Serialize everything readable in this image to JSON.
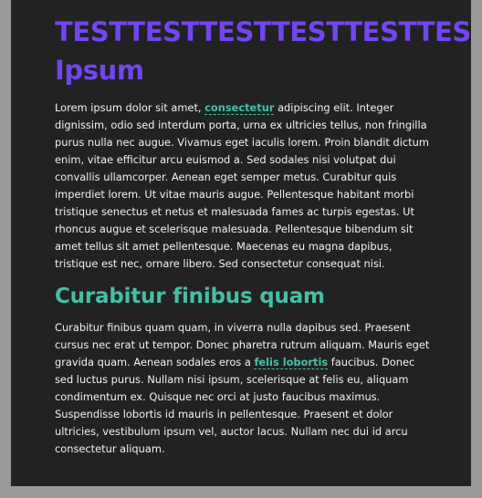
{
  "article": {
    "title_line1": "TESTTESTTESTTESTTESTTESTLorem",
    "title_line2": "Ipsum",
    "para1_before": "Lorem ipsum dolor sit amet, ",
    "para1_link": "consectetur",
    "para1_after": " adipiscing elit. Integer dignissim, odio sed interdum porta, urna ex ultricies tellus, non fringilla purus nulla nec augue. Vivamus eget iaculis lorem. Proin blandit dictum enim, vitae efficitur arcu euismod a. Sed sodales nisi volutpat dui convallis ullamcorper. Aenean eget semper metus. Curabitur quis imperdiet lorem. Ut vitae mauris augue. Pellentesque habitant morbi tristique senectus et netus et malesuada fames ac turpis egestas. Ut rhoncus augue et scelerisque malesuada. Pellentesque bibendum sit amet tellus sit amet pellentesque. Maecenas eu magna dapibus, tristique est nec, ornare libero. Sed consectetur consequat nisi.",
    "subheading": "Curabitur finibus quam",
    "para2_before": "Curabitur finibus quam quam, in viverra nulla dapibus sed. Praesent cursus nec erat ut tempor. Donec pharetra rutrum aliquam. Mauris eget gravida quam. Aenean sodales eros a ",
    "para2_link": "felis lobortis",
    "para2_after": " faucibus. Donec sed luctus purus. Nullam nisi ipsum, scelerisque at felis eu, aliquam condimentum ex. Quisque nec orci at justo faucibus maximus. Suspendisse lobortis id mauris in pellentesque. Praesent et dolor ultricies, vestibulum ipsum vel, auctor lacus. Nullam nec dui id arcu consectetur aliquam."
  },
  "colors": {
    "page_background": "#9a9a9a",
    "card_background": "#222222",
    "title": "#7345f2",
    "subheading": "#46bfa6",
    "link": "#46bfa6",
    "body_text": "#f2f2f2"
  }
}
